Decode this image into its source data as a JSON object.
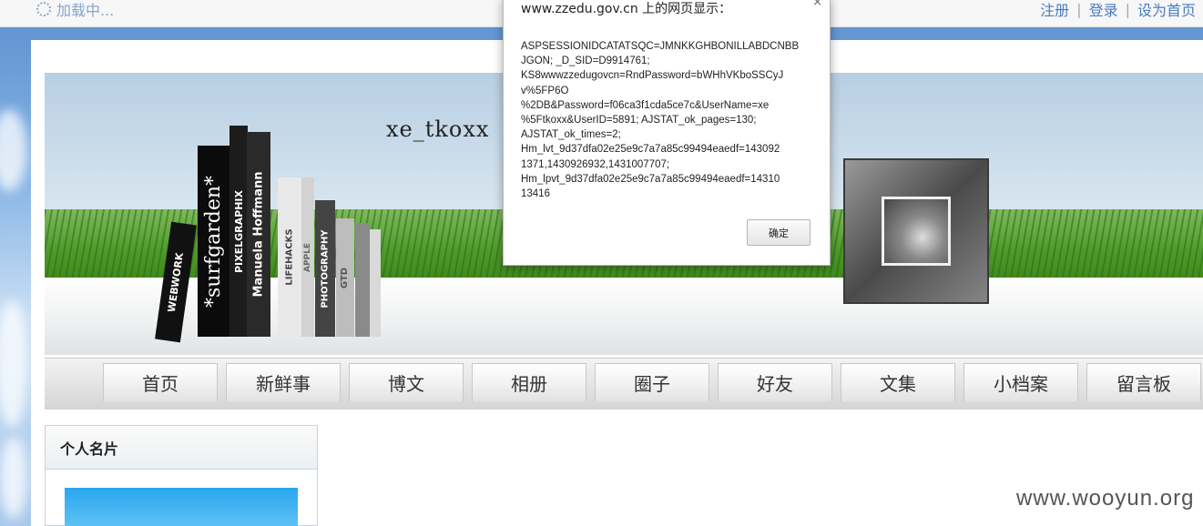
{
  "topbar": {
    "loading_text": "加载中...",
    "links": [
      "注册",
      "登录",
      "设为首页"
    ]
  },
  "banner": {
    "blog_name": "xe_tkoxx",
    "books": [
      "WEBWORK",
      "*surfgarden*",
      "Manuela Hoffmann",
      "PIXELGRAPHIX",
      "LIFEHACKS",
      "APPLE",
      "PHOTOGRAPHY",
      "GTD"
    ]
  },
  "nav": {
    "items": [
      "首页",
      "新鲜事",
      "博文",
      "相册",
      "圈子",
      "好友",
      "文集",
      "小档案",
      "留言板"
    ]
  },
  "sidebar": {
    "card_title": "个人名片"
  },
  "dialog": {
    "title": "www.zzedu.gov.cn 上的网页显示：",
    "close": "×",
    "message_lines": [
      "ASPSESSIONIDCATATSQC=JMNKKGHBONILLABDCNBB",
      "JGON; _D_SID=D9914761;",
      "KS8wwwzzedugovcn=RndPassword=bWHhVKboSSCyJ",
      "v%5FP6O",
      "%2DB&Password=f06ca3f1cda5ce7c&UserName=xe",
      "%5Ftkoxx&UserID=5891; AJSTAT_ok_pages=130;",
      "AJSTAT_ok_times=2;",
      "Hm_lvt_9d37dfa02e25e9c7a7a85c99494eaedf=143092",
      "1371,1430926932,1431007707;",
      "Hm_lpvt_9d37dfa02e25e9c7a7a85c99494eaedf=14310",
      "13416"
    ],
    "ok_label": "确定"
  },
  "watermark": "www.wooyun.org"
}
